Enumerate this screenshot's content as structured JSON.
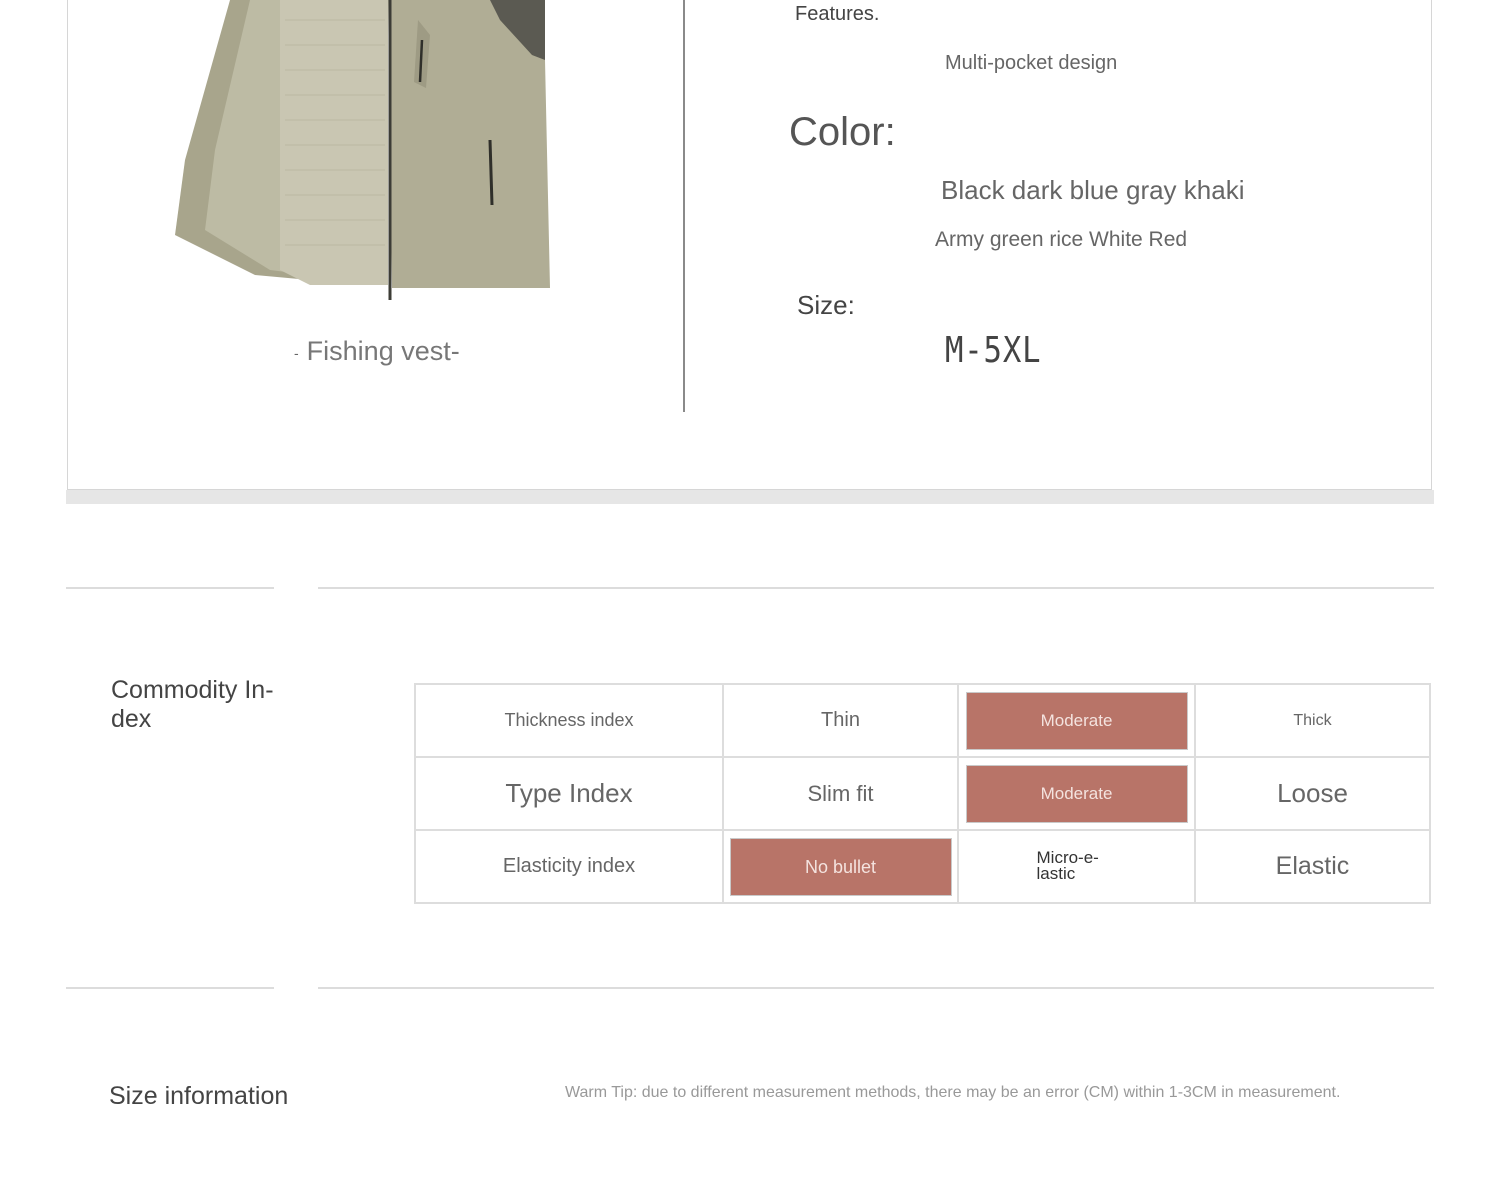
{
  "product": {
    "caption": "Fishing vest-",
    "caption_dash": "-",
    "features_label": "Features.",
    "features_value": "Multi-pocket design",
    "color_label": "Color:",
    "color_value_line1": "Black dark blue gray khaki",
    "color_value_line2": "Army green rice White Red",
    "size_label": "Size:",
    "size_value": "M-5XL",
    "vest_color": "#a9a68f"
  },
  "commodity_index": {
    "title": "Commodity In-dex",
    "highlight_color": "#b87468",
    "rows": [
      {
        "label": "Thickness index",
        "options": [
          "Thin",
          "Moderate",
          "Thick"
        ],
        "selected": 1
      },
      {
        "label": "Type Index",
        "options": [
          "Slim fit",
          "Moderate",
          "Loose"
        ],
        "selected": 1
      },
      {
        "label": "Elasticity index",
        "options": [
          "No bullet",
          "Micro-e-lastic",
          "Elastic"
        ],
        "selected": 0
      }
    ]
  },
  "size_information": {
    "title": "Size information",
    "warm_tip": "Warm Tip: due to different measurement methods, there may be an error (CM) within 1-3CM in measurement."
  }
}
